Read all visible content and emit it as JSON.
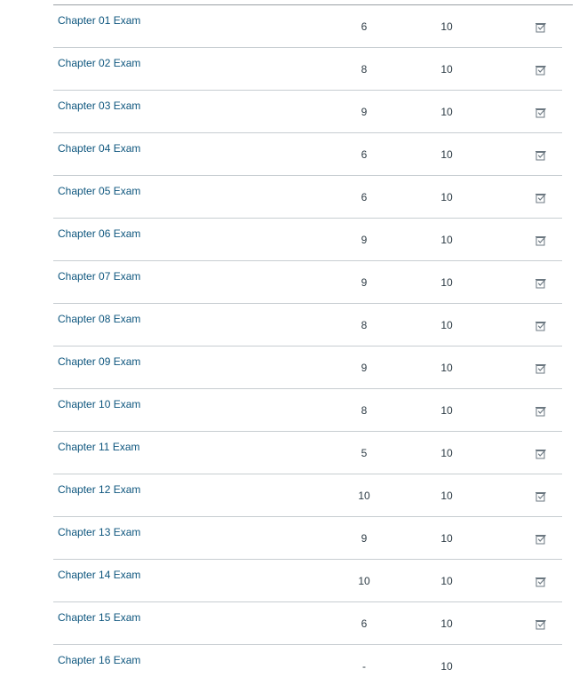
{
  "grades": {
    "rows": [
      {
        "title": "Chapter 01 Exam",
        "score": "6",
        "points_possible": "10",
        "icon": "submission-icon"
      },
      {
        "title": "Chapter 02 Exam",
        "score": "8",
        "points_possible": "10",
        "icon": "submission-icon"
      },
      {
        "title": "Chapter 03 Exam",
        "score": "9",
        "points_possible": "10",
        "icon": "submission-icon"
      },
      {
        "title": "Chapter 04 Exam",
        "score": "6",
        "points_possible": "10",
        "icon": "submission-icon"
      },
      {
        "title": "Chapter 05 Exam",
        "score": "6",
        "points_possible": "10",
        "icon": "submission-icon"
      },
      {
        "title": "Chapter 06 Exam",
        "score": "9",
        "points_possible": "10",
        "icon": "submission-icon"
      },
      {
        "title": "Chapter 07 Exam",
        "score": "9",
        "points_possible": "10",
        "icon": "submission-icon"
      },
      {
        "title": "Chapter 08 Exam",
        "score": "8",
        "points_possible": "10",
        "icon": "submission-icon"
      },
      {
        "title": "Chapter 09 Exam",
        "score": "9",
        "points_possible": "10",
        "icon": "submission-icon"
      },
      {
        "title": "Chapter 10 Exam",
        "score": "8",
        "points_possible": "10",
        "icon": "submission-icon"
      },
      {
        "title": "Chapter 11 Exam",
        "score": "5",
        "points_possible": "10",
        "icon": "submission-icon"
      },
      {
        "title": "Chapter 12 Exam",
        "score": "10",
        "points_possible": "10",
        "icon": "submission-icon"
      },
      {
        "title": "Chapter 13 Exam",
        "score": "9",
        "points_possible": "10",
        "icon": "submission-icon"
      },
      {
        "title": "Chapter 14 Exam",
        "score": "10",
        "points_possible": "10",
        "icon": "submission-icon"
      },
      {
        "title": "Chapter 15 Exam",
        "score": "6",
        "points_possible": "10",
        "icon": "submission-icon"
      },
      {
        "title": "Chapter 16 Exam",
        "score": "-",
        "points_possible": "10",
        "icon": ""
      }
    ]
  },
  "colors": {
    "link": "#0e567e",
    "text": "#2d3b45",
    "divider": "#c7cdd1",
    "icon": "#6b7780"
  }
}
